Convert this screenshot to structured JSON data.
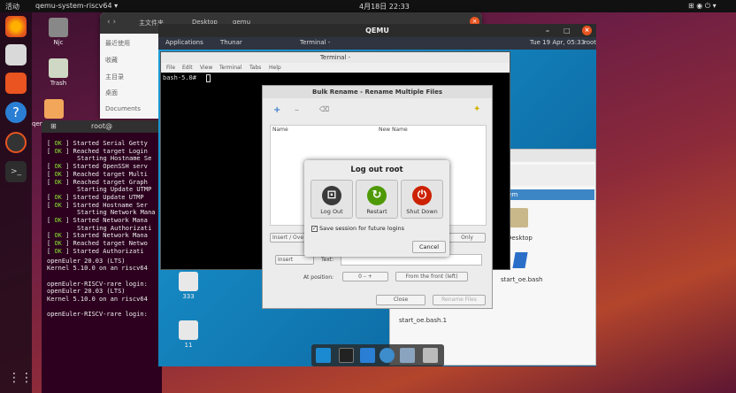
{
  "topbar": {
    "activities": "活动",
    "app_name": "qemu-system-riscv64 ▾",
    "clock": "4月18日 22:33",
    "tray": "⊞  ◉  ⏻ ▾"
  },
  "desktop": {
    "home_label": "Njc",
    "trash_label": "Trash",
    "qemu_label": "qem"
  },
  "files": {
    "sidebar": [
      "最近使用",
      "收藏",
      "主目录",
      "桌面",
      "Documents"
    ],
    "path_parts": [
      "主文件夹",
      "Desktop",
      "qemu"
    ]
  },
  "host_term": {
    "title": "root@",
    "lines": [
      {
        "tag": "OK",
        "text": "] Started Serial Getty"
      },
      {
        "tag": "OK",
        "text": "] Reached target Login"
      },
      {
        "tag": "",
        "text": "Starting Hostname Se"
      },
      {
        "tag": "OK",
        "text": "] Started OpenSSH serv"
      },
      {
        "tag": "OK",
        "text": "] Reached target Multi"
      },
      {
        "tag": "OK",
        "text": "] Reached target Graph"
      },
      {
        "tag": "",
        "text": "Starting Update UTMP"
      },
      {
        "tag": "OK",
        "text": "] Started Update UTMP"
      },
      {
        "tag": "OK",
        "text": "] Started Hostname Ser"
      },
      {
        "tag": "",
        "text": "Starting Network Mana"
      },
      {
        "tag": "OK",
        "text": "] Started Network Mana"
      },
      {
        "tag": "",
        "text": "Starting Authorizati"
      },
      {
        "tag": "OK",
        "text": "] Started Network Mana"
      },
      {
        "tag": "OK",
        "text": "] Reached target Netwo"
      },
      {
        "tag": "OK",
        "text": "] Started Authorizati"
      }
    ],
    "tail": [
      "openEuler 20.03 (LTS)",
      "Kernel 5.10.0 on an riscv64",
      "",
      "openEuler-RISCV-rare login:",
      "openEuler 20.03 (LTS)",
      "Kernel 5.10.0 on an riscv64",
      "",
      "openEuler-RISCV-rare login: "
    ]
  },
  "qemu": {
    "title": "QEMU",
    "panel": {
      "applications": "Applications",
      "thunar": "Thunar",
      "terminal": "Terminal -",
      "clock": "Tue 19 Apr, 05:33",
      "user": "root"
    },
    "desktop_icons": [
      "333",
      "11"
    ],
    "xterm": {
      "title": "Terminal -",
      "menu": [
        "File",
        "Edit",
        "View",
        "Terminal",
        "Tabs",
        "Help"
      ],
      "prompt": "bash-5.0# "
    },
    "bulk": {
      "title": "Bulk Rename - Rename Multiple Files",
      "col_name": "Name",
      "col_new": "New Name",
      "insert_over": "Insert / Ove",
      "only": "Only",
      "insert": "Insert",
      "text_label": "Text:",
      "at_position": "At position:",
      "pos_value": "0",
      "from_front": "From the front (left)",
      "close": "Close",
      "rename_files": "Rename Files"
    },
    "thunar": {
      "selected": "system",
      "files": [
        "Desktop",
        "start_oe.bash",
        "start_oe.bash.1"
      ]
    },
    "logout": {
      "title": "Log out root",
      "logout": "Log Out",
      "restart": "Restart",
      "shutdown": "Shut Down",
      "save_session": "Save session for future logins",
      "cancel": "Cancel"
    }
  },
  "colors": {
    "logout_icon": "#3a3a3a",
    "restart_icon": "#4e9a06",
    "shutdown_icon": "#cc2200"
  }
}
